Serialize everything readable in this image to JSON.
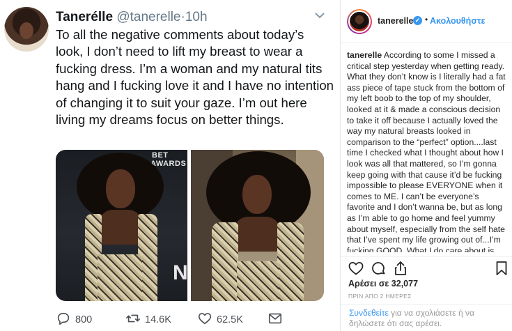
{
  "tweet": {
    "display_name": "Tanerélle",
    "handle": "@tanerelle",
    "separator": "·",
    "time": "10h",
    "text": "To all the negative comments about today’s look, I don’t need to lift my breast to wear a fucking dress. I’m a woman and my natural tits hang and I fucking love it and I have no intention of changing it to suit your gaze. I’m out here living my dreams focus on better things.",
    "photo_1_sign_top": "BET",
    "photo_1_sign": "AWARDS",
    "photo_1_sign_bottom": "N",
    "actions": {
      "replies": "800",
      "retweets": "14.6K",
      "likes": "62.5K"
    }
  },
  "instagram": {
    "username": "tanerelle",
    "verified_mark": "✓",
    "separator": "•",
    "follow_label": "Ακολουθήστε",
    "caption_user": "tanerelle",
    "caption_text": " According to some I missed a critical step yesterday when getting ready. What they don’t know is I literally had a fat ass piece of tape stuck from the bottom of my left boob to the top of my shoulder, looked at it & made a conscious decision to take it off because I actually loved the way my natural breasts looked in comparison to the “perfect” option....last time I checked what I thought about how I look was all that mattered, so I’m gonna keep going with that cause it’d be fucking impossible to please EVERYONE when it comes to ME. I can’t be everyone’s favorite and I don’t wanna be, but as long as I’m able to go home and feel yummy about myself, especially from the self hate that I’ve spent my life growing out of...I’m fucking GOOD. What I do care about is noticing that so many women are still stuck in a daze of self",
    "likes": "Αρέσει σε 32,077",
    "time": "ΠΡΙΝ ΑΠΟ 2 ΗΜΕΡΕΣ",
    "login_link": "Συνδεθείτε",
    "login_text": " για να σχολιάσετε ή να δηλώσετε ότι σας αρέσει."
  },
  "colors": {
    "twitter_text": "#14171a",
    "twitter_muted": "#657786",
    "instagram_blue": "#3897f0",
    "instagram_text": "#262626"
  }
}
